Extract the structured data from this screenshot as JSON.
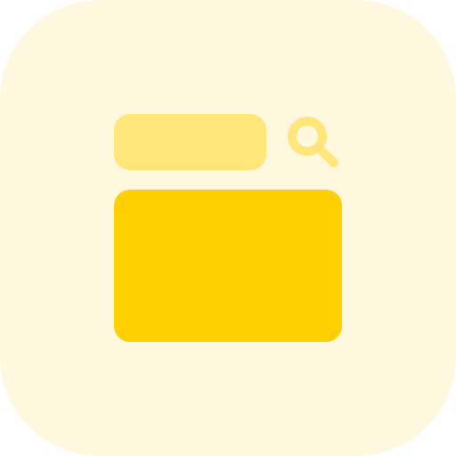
{
  "icon": {
    "semantic": "browser-search-icon",
    "elements": [
      "search-bar",
      "search-icon",
      "content-panel"
    ]
  },
  "colors": {
    "background": "#fff7de",
    "search_bar": "#ffe57a",
    "search_icon": "#ffe57a",
    "content_panel": "#ffcf00"
  }
}
